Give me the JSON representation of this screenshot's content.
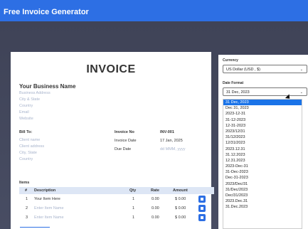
{
  "app": {
    "title": "Free Invoice Generator"
  },
  "invoice": {
    "heading": "INVOICE",
    "business": {
      "name": "Your Business Name",
      "address": "Business Address",
      "city_state": "City & State",
      "country": "Country",
      "email": "Email",
      "website": "Website"
    },
    "bill_to": {
      "label": "Bill To:",
      "client_name": "Client name",
      "client_address": "Client address",
      "city_state": "City, State",
      "country": "Country"
    },
    "meta": {
      "number_label": "Invoice No",
      "number_value": "INV-001",
      "date_label": "Invoice Date",
      "date_value": "17 Jan, 2025",
      "due_label": "Due Date",
      "due_placeholder": "dd MMM, yyyy"
    },
    "items": {
      "label": "Items",
      "columns": [
        "#",
        "Description",
        "Qty",
        "Rate",
        "Amount"
      ],
      "rows": [
        {
          "num": "1",
          "desc": "Your Item Here",
          "qty": "1",
          "rate": "0.00",
          "amount": "$ 0.00"
        },
        {
          "num": "2",
          "desc": "Enter Item Name",
          "qty": "1",
          "rate": "0.00",
          "amount": "$ 0.00"
        },
        {
          "num": "3",
          "desc": "Enter Item Name",
          "qty": "1",
          "rate": "0.00",
          "amount": "$ 0.00"
        }
      ]
    }
  },
  "settings": {
    "currency_label": "Currency",
    "currency_value": "US Dollar (USD , $)",
    "date_format_label": "Date Format",
    "date_format_value": "31 Dec, 2023",
    "date_format_options": [
      "31 Dec, 2023",
      "Dec 31, 2023",
      "2023-12-31",
      "31-12-2023",
      "12-31-2023",
      "2023/12/31",
      "31/12/2023",
      "12/31/2023",
      "2023.12.31",
      "31.12.2023",
      "12.31.2023",
      "2023-Dec-31",
      "31-Dec-2023",
      "Dec-31-2023",
      "2023/Dec/31",
      "31/Dec/2023",
      "Dec/31/2023",
      "2023.Dec.31",
      "31.Dec.2023"
    ],
    "selected_index": 0
  },
  "colors": {
    "accent": "#2d6fe4",
    "selected": "#1a73e8",
    "background": "#454a60"
  }
}
